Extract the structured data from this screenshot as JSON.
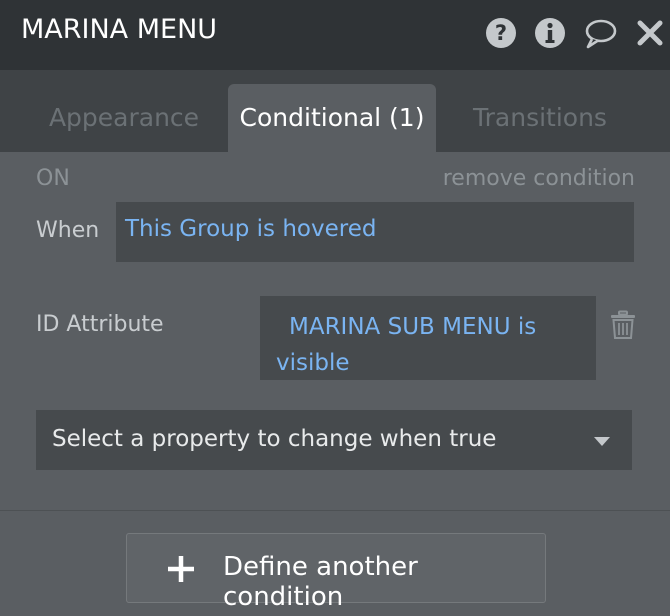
{
  "header": {
    "title": "MARINA MENU",
    "icons": [
      "help-icon",
      "info-icon",
      "comment-icon",
      "close-icon"
    ]
  },
  "tabs": [
    {
      "label": "Appearance",
      "active": false
    },
    {
      "label": "Conditional (1)",
      "active": true
    },
    {
      "label": "Transitions",
      "active": false
    }
  ],
  "condition": {
    "status": "ON",
    "remove_label": "remove condition",
    "when_label": "When",
    "when_value": "This Group is hovered",
    "property_label": "ID Attribute",
    "property_value": "MARINA SUB MENU is visible",
    "select_placeholder": "Select a property to change when true"
  },
  "footer": {
    "define_label": "Define another condition"
  },
  "colors": {
    "header_bg": "#2f3336",
    "tabbar_bg": "#3f4346",
    "panel_bg": "#5a5e62",
    "field_bg": "#464a4d",
    "link_blue": "#7ab4f2",
    "muted_text": "#8c9296"
  }
}
